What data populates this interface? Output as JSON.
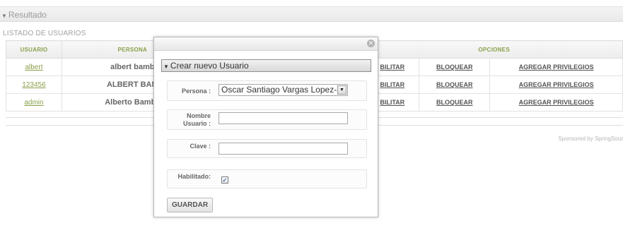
{
  "result": {
    "title": "Resultado",
    "list_title": "LISTADO DE USUARIOS"
  },
  "table": {
    "headers": {
      "usuario": "USUARIO",
      "persona": "PERSONA",
      "opciones": "OPCIONES"
    },
    "rows": [
      {
        "usuario": "albert",
        "persona": "albert bamb",
        "opt1": "BILITAR",
        "opt2": "BLOQUEAR",
        "opt3": "AGREGAR PRIVILEGIOS"
      },
      {
        "usuario": "123456",
        "persona": "ALBERT BAM",
        "opt1": "BILITAR",
        "opt2": "BLOQUEAR",
        "opt3": "AGREGAR PRIVILEGIOS"
      },
      {
        "usuario": "admin",
        "persona": "Alberto Bamba",
        "opt1": "BILITAR",
        "opt2": "BLOQUEAR",
        "opt3": "AGREGAR PRIVILEGIOS"
      }
    ]
  },
  "footer": {
    "sponsor": "Sponsored by SpringSour"
  },
  "modal": {
    "close_icon": "close-icon",
    "legend": "Crear nuevo Usuario",
    "persona_label": "Persona :",
    "persona_value": "Oscar Santiago Vargas Lopez-Y",
    "nombre_label_1": "Nombre",
    "nombre_label_2": "Usuario :",
    "nombre_value": "",
    "clave_label": "Clave :",
    "clave_value": "",
    "habilitado_label": "Habilitado:",
    "habilitado_checked": true,
    "save_label": "GUARDAR"
  },
  "colors": {
    "link_green": "#8aa04a",
    "header_bg": "#ececec"
  }
}
